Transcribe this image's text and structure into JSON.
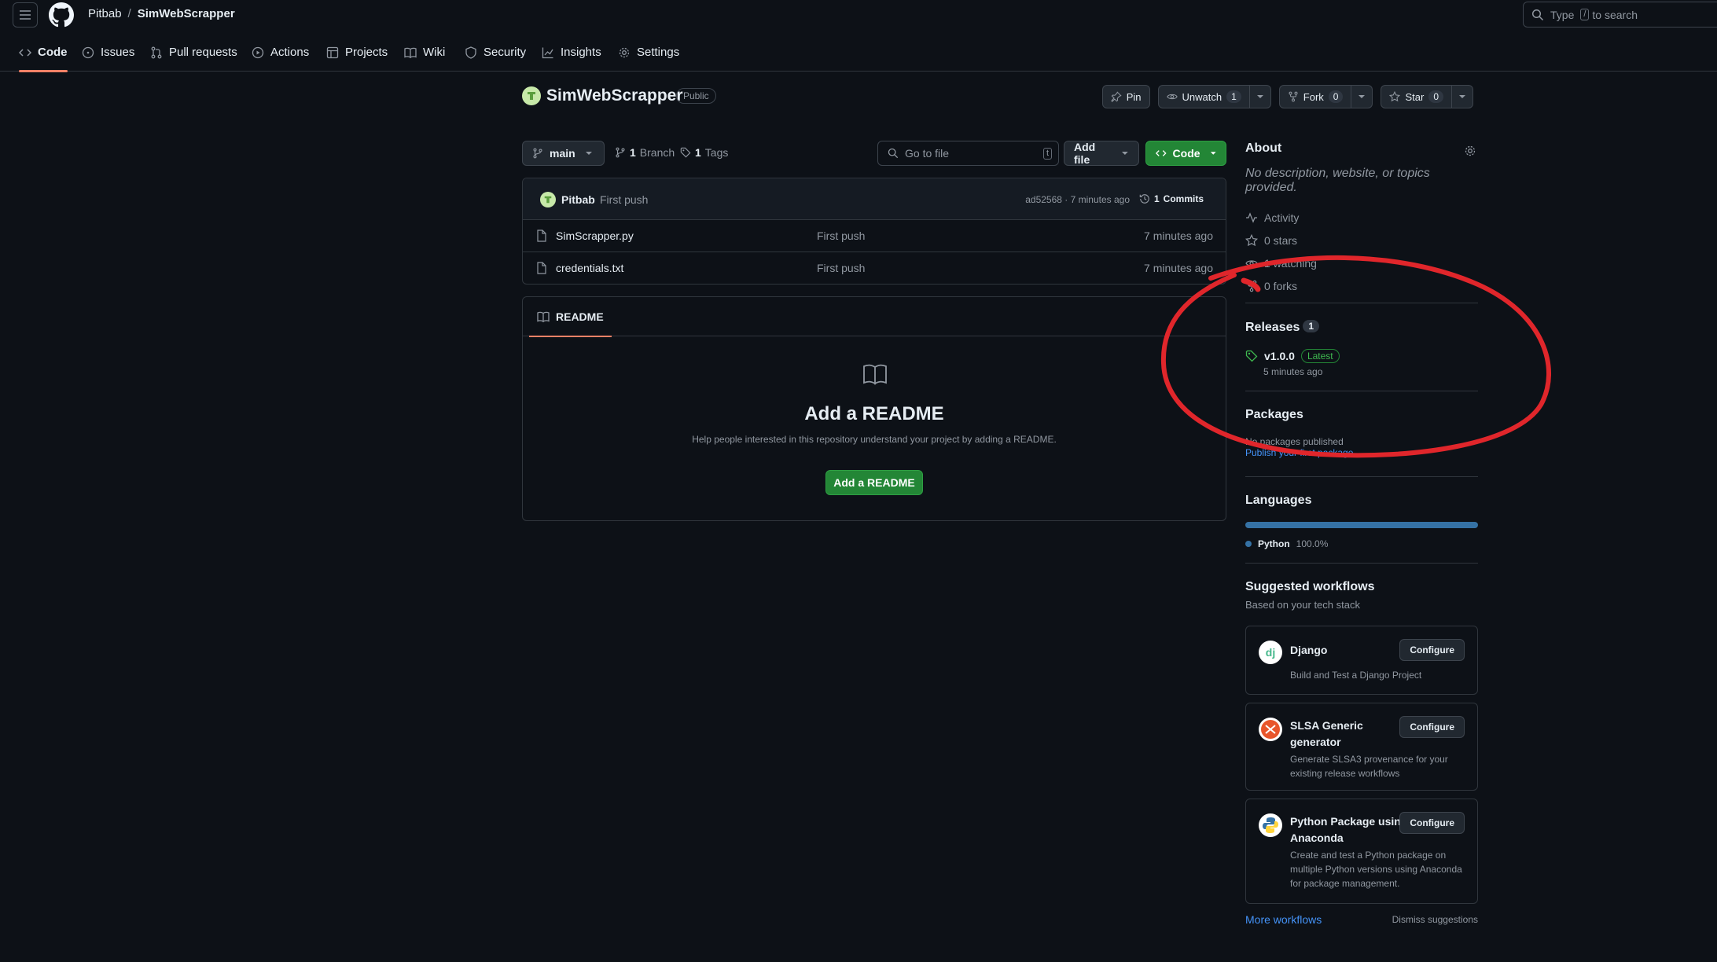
{
  "header": {
    "owner": "Pitbab",
    "separator": "/",
    "repo": "SimWebScrapper",
    "search_placeholder_pre": "Type",
    "search_key": "/",
    "search_placeholder_post": "to search"
  },
  "nav": {
    "tabs": [
      {
        "label": "Code",
        "icon": "code-icon",
        "active": true
      },
      {
        "label": "Issues",
        "icon": "issue-icon"
      },
      {
        "label": "Pull requests",
        "icon": "pull-request-icon"
      },
      {
        "label": "Actions",
        "icon": "play-icon"
      },
      {
        "label": "Projects",
        "icon": "table-icon"
      },
      {
        "label": "Wiki",
        "icon": "book-icon"
      },
      {
        "label": "Security",
        "icon": "shield-icon"
      },
      {
        "label": "Insights",
        "icon": "graph-icon"
      },
      {
        "label": "Settings",
        "icon": "gear-icon"
      }
    ]
  },
  "repo": {
    "name": "SimWebScrapper",
    "visibility": "Public",
    "pin_label": "Pin",
    "unwatch_label": "Unwatch",
    "watch_count": "1",
    "fork_label": "Fork",
    "fork_count": "0",
    "star_label": "Star",
    "star_count": "0"
  },
  "toolbar": {
    "branch": "main",
    "branch_count": "1",
    "branch_label": "Branch",
    "tag_count": "1",
    "tag_label": "Tags",
    "goto_placeholder": "Go to file",
    "goto_key": "t",
    "add_file_label": "Add file",
    "code_label": "Code"
  },
  "latest_commit": {
    "author": "Pitbab",
    "message": "First push",
    "sha_time": "ad52568 · 7 minutes ago",
    "commits_count": "1",
    "commits_label": "Commits"
  },
  "files": [
    {
      "name": "SimScrapper.py",
      "message": "First push",
      "date": "7 minutes ago"
    },
    {
      "name": "credentials.txt",
      "message": "First push",
      "date": "7 minutes ago"
    }
  ],
  "readme": {
    "tab_label": "README",
    "title": "Add a README",
    "help": "Help people interested in this repository understand your project by adding a README.",
    "button": "Add a README"
  },
  "about": {
    "heading": "About",
    "description": "No description, website, or topics provided.",
    "items": [
      {
        "label": "Activity",
        "icon": "pulse-icon"
      },
      {
        "label": "0 stars",
        "icon": "star-icon"
      },
      {
        "label": "1 watching",
        "icon": "eye-icon"
      },
      {
        "label": "0 forks",
        "icon": "fork-icon"
      }
    ]
  },
  "releases": {
    "heading": "Releases",
    "count": "1",
    "version": "v1.0.0",
    "latest_label": "Latest",
    "time": "5 minutes ago"
  },
  "packages": {
    "heading": "Packages",
    "none": "No packages published",
    "publish_link": "Publish your first package"
  },
  "languages": {
    "heading": "Languages",
    "items": [
      {
        "name": "Python",
        "percent": "100.0%",
        "color": "#3572a5"
      }
    ]
  },
  "workflows": {
    "heading": "Suggested workflows",
    "subheading": "Based on your tech stack",
    "cards": [
      {
        "title": "Django",
        "desc": "Build and Test a Django Project",
        "button": "Configure",
        "logo": "dj"
      },
      {
        "title": "SLSA Generic generator",
        "desc": "Generate SLSA3 provenance for your existing release workflows",
        "button": "Configure",
        "logo": "slsa-logo"
      },
      {
        "title": "Python Package using Anaconda",
        "desc": "Create and test a Python package on multiple Python versions using Anaconda for package management.",
        "button": "Configure",
        "logo": "python-logo"
      }
    ],
    "more_link": "More workflows",
    "dismiss": "Dismiss suggestions"
  },
  "colors": {
    "background": "#0d1117",
    "accent_green": "#238636",
    "tab_underline": "#f78166",
    "link": "#4493f8",
    "annotation_red": "#e0262b"
  }
}
